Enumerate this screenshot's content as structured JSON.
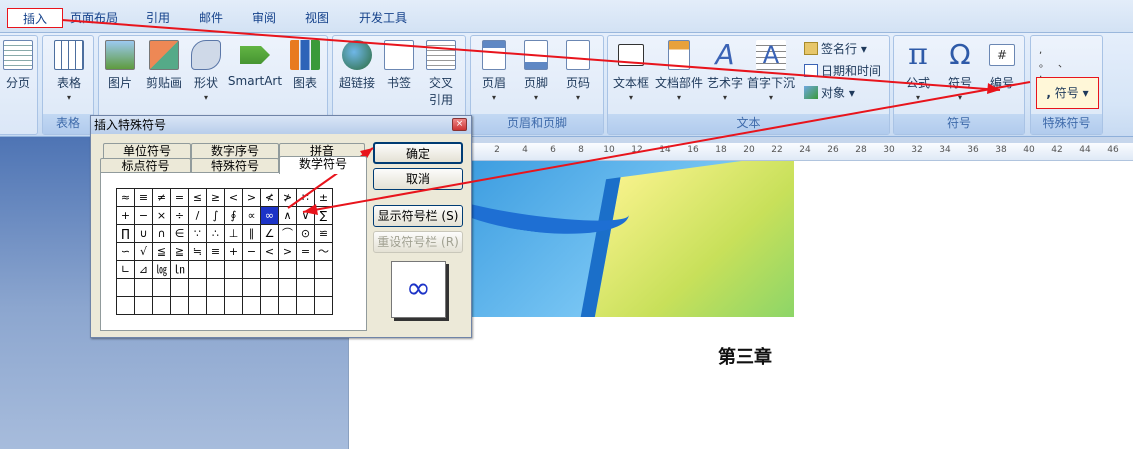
{
  "tabs": [
    "插入",
    "页面布局",
    "引用",
    "邮件",
    "审阅",
    "视图",
    "开发工具"
  ],
  "ribbon": {
    "page_break": "分页",
    "table": "表格",
    "table_group": "表格",
    "picture": "图片",
    "clipart": "剪贴画",
    "shapes": "形状",
    "smartart": "SmartArt",
    "chart": "图表",
    "hyperlink": "超链接",
    "bookmark": "书签",
    "crossref_1": "交叉",
    "crossref_2": "引用",
    "header": "页眉",
    "footer": "页脚",
    "page_number": "页码",
    "header_footer_group": "页眉和页脚",
    "textbox": "文本框",
    "quickparts": "文档部件",
    "wordart": "艺术字",
    "dropcap": "首字下沉",
    "signature": "签名行",
    "datetime": "日期和时间",
    "object": "对象",
    "text_group": "文本",
    "equation": "公式",
    "symbol": "符号",
    "numbering": "编号",
    "symbol_group": "符号",
    "special_symbol": "符号",
    "special_group": "特殊符号"
  },
  "ruler_numbers": [
    "2",
    "4",
    "6",
    "8",
    "10",
    "12",
    "14",
    "16",
    "18",
    "20",
    "22",
    "24",
    "26",
    "28",
    "30",
    "32",
    "34",
    "36",
    "38",
    "40",
    "42",
    "44",
    "46"
  ],
  "document": {
    "chapter_title": "第三章"
  },
  "dialog": {
    "title": "插入特殊符号",
    "close": "×",
    "tabs_row1": [
      "单位符号",
      "数字序号",
      "拼音"
    ],
    "tabs_row2": [
      "标点符号",
      "特殊符号",
      "数学符号"
    ],
    "ok_button": "确定",
    "cancel_button": "取消",
    "show_bar_button": "显示符号栏 (S)",
    "reset_bar_button": "重设符号栏 (R)",
    "preview_symbol": "∞",
    "grid": [
      [
        "≈",
        "≡",
        "≠",
        "=",
        "≤",
        "≥",
        "<",
        ">",
        "≮",
        "≯",
        "∷",
        "±"
      ],
      [
        "+",
        "−",
        "×",
        "÷",
        "/",
        "∫",
        "∮",
        "∝",
        "∞",
        "∧",
        "∨",
        "∑"
      ],
      [
        "∏",
        "∪",
        "∩",
        "∈",
        "∵",
        "∴",
        "⊥",
        "∥",
        "∠",
        "⌒",
        "⊙",
        "≌"
      ],
      [
        "∽",
        "√",
        "≦",
        "≧",
        "≒",
        "≡",
        "+",
        "−",
        "<",
        ">",
        "=",
        "～"
      ],
      [
        "∟",
        "⊿",
        "㏒",
        "㏑",
        "",
        "",
        "",
        "",
        "",
        "",
        "",
        ""
      ],
      [
        "",
        "",
        "",
        "",
        "",
        "",
        "",
        "",
        "",
        "",
        "",
        ""
      ],
      [
        "",
        "",
        "",
        "",
        "",
        "",
        "",
        "",
        "",
        "",
        "",
        ""
      ]
    ],
    "selected": {
      "row": 1,
      "col": 8
    }
  },
  "colors": {
    "accent": "#1c33c7",
    "annotation": "#e8141c"
  }
}
